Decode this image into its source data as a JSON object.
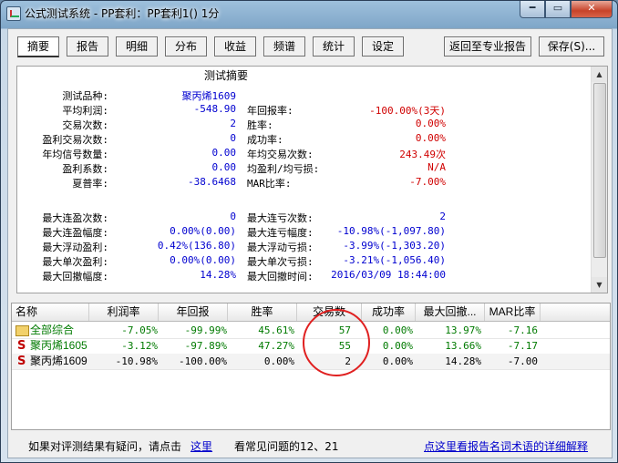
{
  "window": {
    "title": "公式测试系统 - PP套利：PP套利1() 1分",
    "controls": [
      "━",
      "▭",
      "✕"
    ]
  },
  "tabs": [
    "摘要",
    "报告",
    "明细",
    "分布",
    "收益",
    "频谱",
    "统计",
    "设定"
  ],
  "active_tab": "摘要",
  "buttons": {
    "back": "返回至专业报告",
    "save": "保存(S)..."
  },
  "summary": {
    "heading": "测试摘要",
    "left": [
      {
        "label": "测试品种:",
        "value": "聚丙烯1609"
      },
      {
        "label": "平均利润:",
        "value": "-548.90"
      },
      {
        "label": "交易次数:",
        "value": "2"
      },
      {
        "label": "盈利交易次数:",
        "value": "0"
      },
      {
        "label": "年均信号数量:",
        "value": "0.00"
      },
      {
        "label": "盈利系数:",
        "value": "0.00"
      },
      {
        "label": "夏普率:",
        "value": "-38.6468"
      },
      {
        "label": "",
        "value": ""
      },
      {
        "label": "最大连盈次数:",
        "value": "0"
      },
      {
        "label": "最大连盈幅度:",
        "value": "0.00%(0.00)"
      },
      {
        "label": "最大浮动盈利:",
        "value": "0.42%(136.80)"
      },
      {
        "label": "最大单次盈利:",
        "value": "0.00%(0.00)"
      },
      {
        "label": "最大回撤幅度:",
        "value": "14.28%"
      }
    ],
    "right": [
      {
        "label": "",
        "value": ""
      },
      {
        "label": "年回报率:",
        "value": "-100.00%(3天)",
        "red": true
      },
      {
        "label": "胜率:",
        "value": "0.00%",
        "red": true
      },
      {
        "label": "成功率:",
        "value": "0.00%",
        "red": true
      },
      {
        "label": "年均交易次数:",
        "value": "243.49次",
        "red": true
      },
      {
        "label": "均盈利/均亏损:",
        "value": "N/A",
        "red": true
      },
      {
        "label": "MAR比率:",
        "value": "-7.00%",
        "red": true
      },
      {
        "label": "",
        "value": ""
      },
      {
        "label": "最大连亏次数:",
        "value": "2"
      },
      {
        "label": "最大连亏幅度:",
        "value": "-10.98%(-1,097.80)"
      },
      {
        "label": "最大浮动亏损:",
        "value": "-3.99%(-1,303.20)"
      },
      {
        "label": "最大单次亏损:",
        "value": "-3.21%(-1,056.40)"
      },
      {
        "label": "最大回撤时间:",
        "value": "2016/03/09 18:44:00"
      }
    ]
  },
  "grid": {
    "columns": [
      "名称",
      "利润率",
      "年回报",
      "胜率",
      "交易数",
      "成功率",
      "最大回撤...",
      "MAR比率"
    ],
    "rows": [
      {
        "icon": "folder-icon",
        "name": "全部综合",
        "profit": "-7.05%",
        "annual": "-99.99%",
        "winrate": "45.61%",
        "trades": "57",
        "success": "0.00%",
        "drawdown": "13.97%",
        "mar": "-7.16",
        "color": "g"
      },
      {
        "icon": "s-icon",
        "name": "聚丙烯1605",
        "profit": "-3.12%",
        "annual": "-97.89%",
        "winrate": "47.27%",
        "trades": "55",
        "success": "0.00%",
        "drawdown": "13.66%",
        "mar": "-7.17",
        "color": "g"
      },
      {
        "icon": "s-icon",
        "name": "聚丙烯1609",
        "profit": "-10.98%",
        "annual": "-100.00%",
        "winrate": "0.00%",
        "trades": "2",
        "success": "0.00%",
        "drawdown": "14.28%",
        "mar": "-7.00",
        "color": "k"
      }
    ]
  },
  "footer": {
    "prefix": "如果对评测结果有疑问，请点击",
    "link1": "这里",
    "middle": "看常见问题的12、21",
    "link2": "点这里看报告名词术语的详细解释"
  }
}
